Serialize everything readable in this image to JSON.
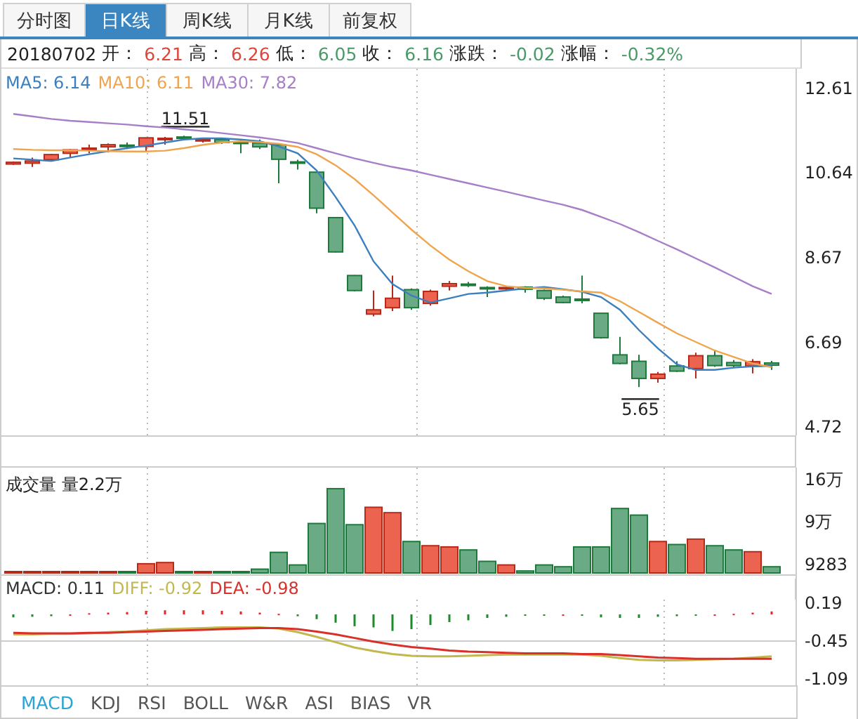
{
  "tabs": [
    {
      "label": "分时图",
      "selected": false
    },
    {
      "label": "日K线",
      "selected": true
    },
    {
      "label": "周K线",
      "selected": false
    },
    {
      "label": "月K线",
      "selected": false
    },
    {
      "label": "前复权",
      "selected": false
    }
  ],
  "quote": {
    "date": "20180702",
    "fields": [
      {
        "label": "开：",
        "value": "6.21",
        "color": "#e0453a"
      },
      {
        "label": "高：",
        "value": "6.26",
        "color": "#e0453a"
      },
      {
        "label": "低：",
        "value": "6.05",
        "color": "#4a9a68"
      },
      {
        "label": "收：",
        "value": "6.16",
        "color": "#4a9a68"
      },
      {
        "label": "涨跌：",
        "value": "-0.02",
        "color": "#4a9a68"
      },
      {
        "label": "涨幅：",
        "value": "-0.32%",
        "color": "#4a9a68"
      }
    ]
  },
  "price_panel": {
    "legend": [
      {
        "text": "MA5: 6.14",
        "color": "#3b7fbf"
      },
      {
        "text": "MA10: 6.11",
        "color": "#eea54e"
      },
      {
        "text": "MA30: 7.82",
        "color": "#a77fc8"
      }
    ],
    "candle_chart": {
      "chart_data": {
        "type": "candlestick",
        "ylim": [
          3.77,
          13.07
        ],
        "categories": [
          null,
          null,
          null,
          null,
          null,
          null,
          null,
          null,
          null,
          null,
          null,
          null,
          null,
          null,
          null,
          null,
          null,
          null,
          null,
          null,
          null,
          null,
          null,
          null,
          null,
          null,
          null,
          null,
          null,
          null,
          null,
          null,
          null,
          null,
          null,
          null,
          null,
          null,
          null,
          null,
          null
        ],
        "ohlc": [
          [
            10.85,
            10.91,
            10.83,
            10.89
          ],
          [
            10.87,
            11.0,
            10.78,
            10.92
          ],
          [
            10.95,
            11.09,
            10.93,
            11.07
          ],
          [
            11.1,
            11.2,
            11.0,
            11.18
          ],
          [
            11.2,
            11.3,
            11.1,
            11.22
          ],
          [
            11.25,
            11.33,
            11.12,
            11.3
          ],
          [
            11.29,
            11.35,
            11.2,
            11.28
          ],
          [
            11.26,
            11.47,
            11.14,
            11.46
          ],
          [
            11.43,
            11.48,
            11.3,
            11.45
          ],
          [
            11.48,
            11.51,
            11.4,
            11.47
          ],
          [
            11.4,
            11.45,
            11.35,
            11.42
          ],
          [
            11.42,
            11.44,
            11.32,
            11.35
          ],
          [
            11.36,
            11.38,
            11.1,
            11.33
          ],
          [
            11.34,
            11.42,
            11.2,
            11.25
          ],
          [
            11.3,
            11.31,
            10.4,
            10.96
          ],
          [
            10.9,
            10.95,
            10.72,
            10.89
          ],
          [
            10.66,
            10.67,
            9.7,
            9.82
          ],
          [
            9.6,
            9.61,
            8.79,
            8.8
          ],
          [
            8.25,
            8.26,
            7.88,
            7.9
          ],
          [
            7.35,
            7.9,
            7.3,
            7.45
          ],
          [
            7.5,
            8.25,
            7.42,
            7.72
          ],
          [
            7.92,
            7.95,
            7.45,
            7.5
          ],
          [
            7.6,
            7.92,
            7.55,
            7.88
          ],
          [
            8.0,
            8.12,
            7.9,
            8.06
          ],
          [
            8.05,
            8.1,
            7.98,
            8.03
          ],
          [
            7.97,
            8.0,
            7.75,
            7.95
          ],
          [
            7.96,
            8.0,
            7.9,
            7.97
          ],
          [
            7.98,
            8.0,
            7.85,
            7.93
          ],
          [
            7.9,
            7.92,
            7.68,
            7.72
          ],
          [
            7.75,
            7.78,
            7.6,
            7.62
          ],
          [
            7.7,
            8.25,
            7.6,
            7.69
          ],
          [
            7.37,
            7.38,
            6.78,
            6.8
          ],
          [
            6.4,
            6.82,
            6.18,
            6.2
          ],
          [
            6.25,
            6.4,
            5.65,
            5.85
          ],
          [
            5.85,
            6.0,
            5.75,
            5.95
          ],
          [
            6.14,
            6.25,
            6.0,
            6.02
          ],
          [
            6.08,
            6.45,
            5.85,
            6.38
          ],
          [
            6.38,
            6.52,
            6.12,
            6.15
          ],
          [
            6.22,
            6.28,
            6.1,
            6.15
          ],
          [
            6.14,
            6.3,
            5.97,
            6.24
          ],
          [
            6.21,
            6.26,
            6.05,
            6.16
          ]
        ],
        "annotations": [
          {
            "text": "11.51",
            "y": 11.51
          },
          {
            "text": "5.65",
            "y": 5.65
          }
        ]
      }
    },
    "average_chart": {
      "chart_data": {
        "type": "line",
        "ylim": [
          3.77,
          13.07
        ],
        "yticks": [
          12.61,
          10.64,
          8.67,
          6.69,
          4.72
        ],
        "series": [
          {
            "color": "#3b7fbf",
            "values": [
              10.98,
              10.95,
              10.92,
              11.0,
              11.08,
              11.15,
              11.22,
              11.28,
              11.35,
              11.42,
              11.45,
              11.45,
              11.42,
              11.38,
              11.26,
              11.1,
              10.7,
              10.08,
              9.42,
              8.58,
              8.05,
              7.78,
              7.62,
              7.72,
              7.82,
              7.85,
              7.9,
              7.95,
              7.98,
              7.93,
              7.87,
              7.75,
              7.45,
              6.98,
              6.55,
              6.18,
              6.05,
              6.05,
              6.1,
              6.13,
              6.14
            ]
          },
          {
            "color": "#eea54e",
            "values": [
              11.2,
              11.18,
              11.17,
              11.17,
              11.16,
              11.15,
              11.14,
              11.14,
              11.16,
              11.22,
              11.3,
              11.35,
              11.38,
              11.36,
              11.32,
              11.25,
              11.08,
              10.82,
              10.5,
              10.12,
              9.72,
              9.32,
              8.95,
              8.62,
              8.35,
              8.12,
              8.0,
              7.96,
              7.95,
              7.92,
              7.88,
              7.85,
              7.65,
              7.4,
              7.15,
              6.9,
              6.7,
              6.5,
              6.35,
              6.2,
              6.11
            ]
          },
          {
            "color": "#a77fc8",
            "values": [
              12.02,
              11.96,
              11.9,
              11.86,
              11.83,
              11.8,
              11.77,
              11.73,
              11.7,
              11.66,
              11.62,
              11.57,
              11.52,
              11.47,
              11.41,
              11.34,
              11.22,
              11.1,
              10.98,
              10.88,
              10.78,
              10.7,
              10.6,
              10.5,
              10.4,
              10.3,
              10.2,
              10.1,
              10.0,
              9.9,
              9.78,
              9.62,
              9.45,
              9.26,
              9.06,
              8.86,
              8.65,
              8.44,
              8.22,
              8.0,
              7.82
            ]
          }
        ]
      }
    }
  },
  "volume_panel": {
    "label": "成交量 量2.2万",
    "min_label": "9283",
    "chart_data": {
      "type": "bar",
      "ylim": [
        0,
        18
      ],
      "yticks": [
        {
          "value": 16,
          "label": "16万"
        },
        {
          "value": 9,
          "label": "9万"
        }
      ],
      "series": [
        {
          "color": "#ec6450",
          "values": [
            0.2,
            0.2,
            0.2,
            0.2,
            0.2,
            0.6,
            null,
            2.0,
            2.2,
            null,
            0.4,
            null,
            null,
            null,
            null,
            null,
            null,
            null,
            null,
            11.4,
            10.5,
            null,
            5.0,
            4.8,
            null,
            null,
            1.8,
            null,
            null,
            null,
            null,
            null,
            null,
            null,
            5.7,
            null,
            6.1,
            null,
            null,
            4.0,
            null
          ]
        },
        {
          "color": "#6aab86",
          "values": [
            null,
            null,
            null,
            null,
            null,
            null,
            0.2,
            null,
            null,
            0.1,
            null,
            0.4,
            0.1,
            1.1,
            3.9,
            1.8,
            8.7,
            14.5,
            8.5,
            null,
            null,
            5.7,
            null,
            null,
            4.3,
            2.4,
            null,
            0.8,
            1.8,
            1.5,
            4.8,
            4.8,
            11.2,
            10.1,
            null,
            5.2,
            null,
            5.0,
            4.3,
            null,
            1.5
          ]
        }
      ]
    }
  },
  "macd_panel": {
    "legend": [
      {
        "text": "MACD: 0.11",
        "color": "#333333"
      },
      {
        "text": "DIFF: -0.92",
        "color": "#c2b84e"
      },
      {
        "text": "DEA: -0.98",
        "color": "#d9302a"
      }
    ],
    "chart_data": {
      "type": "line",
      "ylim": [
        -1.2,
        0.25
      ],
      "yticks": [
        0.19,
        -0.45,
        -1.09
      ],
      "series": [
        {
          "type": "bar",
          "color": "#e8252a",
          "values": [
            null,
            null,
            null,
            0,
            0.02,
            0.03,
            0.04,
            0.06,
            0.07,
            0.07,
            0.07,
            0.06,
            0.05,
            0.03,
            0.01,
            null,
            null,
            null,
            null,
            null,
            null,
            null,
            null,
            null,
            null,
            null,
            null,
            null,
            null,
            0,
            null,
            null,
            null,
            null,
            null,
            null,
            null,
            0,
            0.01,
            0.03,
            0.05
          ]
        },
        {
          "type": "bar",
          "color": "#1a8c2a",
          "values": [
            -0.05,
            -0.04,
            -0.03,
            null,
            null,
            null,
            null,
            null,
            null,
            null,
            null,
            null,
            null,
            null,
            null,
            -0.03,
            -0.08,
            -0.14,
            -0.2,
            -0.22,
            -0.28,
            -0.25,
            -0.18,
            -0.13,
            -0.1,
            -0.06,
            -0.04,
            -0.02,
            -0.01,
            null,
            -0.01,
            -0.05,
            -0.06,
            -0.06,
            -0.04,
            -0.03,
            -0.02,
            null,
            null,
            null,
            null
          ]
        },
        {
          "type": "line",
          "color": "#c2b84e",
          "values": [
            -0.34,
            -0.34,
            -0.33,
            -0.33,
            -0.32,
            -0.3,
            -0.29,
            -0.27,
            -0.25,
            -0.24,
            -0.23,
            -0.22,
            -0.22,
            -0.22,
            -0.24,
            -0.3,
            -0.38,
            -0.47,
            -0.56,
            -0.62,
            -0.67,
            -0.7,
            -0.71,
            -0.71,
            -0.7,
            -0.69,
            -0.68,
            -0.68,
            -0.68,
            -0.68,
            -0.68,
            -0.7,
            -0.74,
            -0.77,
            -0.78,
            -0.78,
            -0.77,
            -0.76,
            -0.75,
            -0.73,
            -0.71
          ]
        },
        {
          "type": "line",
          "color": "#d9302a",
          "values": [
            -0.31,
            -0.32,
            -0.32,
            -0.32,
            -0.31,
            -0.31,
            -0.3,
            -0.29,
            -0.28,
            -0.27,
            -0.26,
            -0.25,
            -0.24,
            -0.23,
            -0.23,
            -0.25,
            -0.29,
            -0.34,
            -0.4,
            -0.46,
            -0.51,
            -0.55,
            -0.58,
            -0.61,
            -0.63,
            -0.64,
            -0.65,
            -0.66,
            -0.66,
            -0.66,
            -0.67,
            -0.67,
            -0.69,
            -0.71,
            -0.73,
            -0.74,
            -0.75,
            -0.75,
            -0.75,
            -0.75,
            -0.75
          ]
        }
      ]
    }
  },
  "indicator_tabs": [
    {
      "label": "MACD",
      "selected": true
    },
    {
      "label": "KDJ",
      "selected": false
    },
    {
      "label": "RSI",
      "selected": false
    },
    {
      "label": "BOLL",
      "selected": false
    },
    {
      "label": "W&R",
      "selected": false
    },
    {
      "label": "ASI",
      "selected": false
    },
    {
      "label": "BIAS",
      "selected": false
    },
    {
      "label": "VR",
      "selected": false
    }
  ]
}
